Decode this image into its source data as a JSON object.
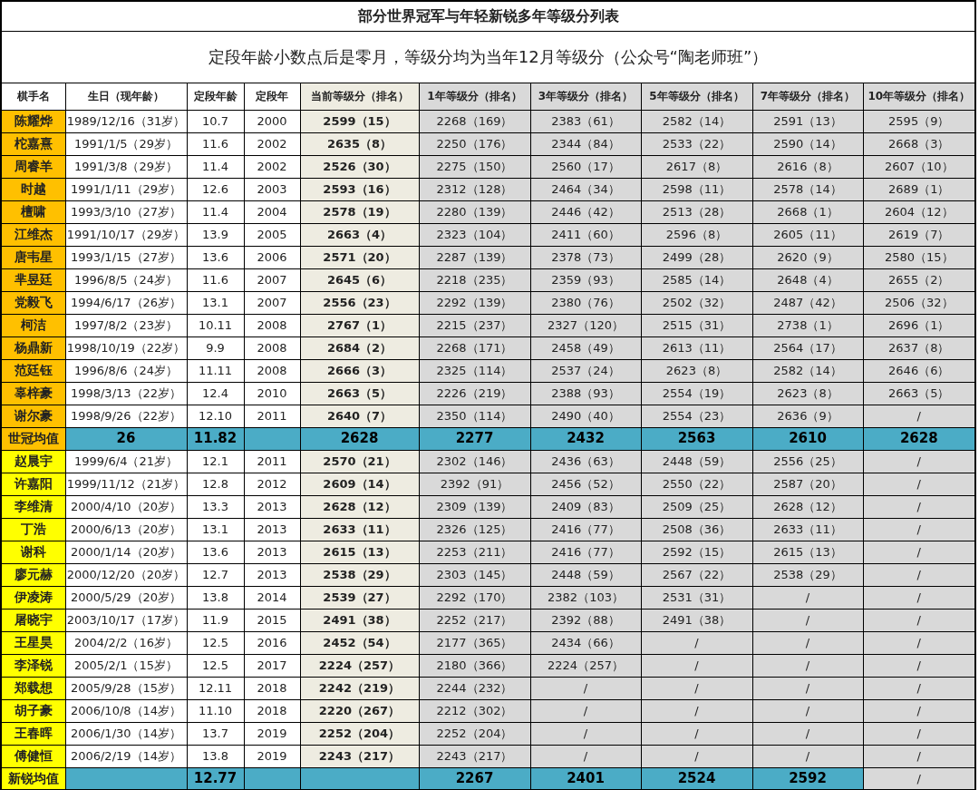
{
  "title": "部分世界冠军与年轻新锐多年等级分列表",
  "subtitle": "定段年龄小数点后是零月，等级分均为当年12月等级分（公众号“陶老师班”）",
  "columns": [
    "棋手名",
    "生日（现年龄）",
    "定段年龄",
    "定段年",
    "当前等级分（排名）",
    "1年等级分（排名）",
    "3年等级分（排名）",
    "5年等级分（排名）",
    "7年等级分（排名）",
    "10年等级分（排名）"
  ],
  "sections": [
    {
      "kind": "champion",
      "players": [
        [
          "陈耀烨",
          "1989/12/16（31岁）",
          "10.7",
          "2000",
          "2599（15）",
          "2268（169）",
          "2383（61）",
          "2582（14）",
          "2591（13）",
          "2595（9）"
        ],
        [
          "柁嘉熹",
          "1991/1/5（29岁）",
          "11.6",
          "2002",
          "2635（8）",
          "2250（176）",
          "2344（84）",
          "2533（22）",
          "2590（14）",
          "2668（3）"
        ],
        [
          "周睿羊",
          "1991/3/8（29岁）",
          "11.4",
          "2002",
          "2526（30）",
          "2275（150）",
          "2560（17）",
          "2617（8）",
          "2616（8）",
          "2607（10）"
        ],
        [
          "时越",
          "1991/1/11（29岁）",
          "12.6",
          "2003",
          "2593（16）",
          "2312（128）",
          "2464（34）",
          "2598（11）",
          "2578（14）",
          "2689（1）"
        ],
        [
          "檀啸",
          "1993/3/10（27岁）",
          "11.4",
          "2004",
          "2578（19）",
          "2280（139）",
          "2446（42）",
          "2513（28）",
          "2668（1）",
          "2604（12）"
        ],
        [
          "江维杰",
          "1991/10/17（29岁）",
          "13.9",
          "2005",
          "2663（4）",
          "2323（104）",
          "2411（60）",
          "2596（8）",
          "2605（11）",
          "2619（7）"
        ],
        [
          "唐韦星",
          "1993/1/15（27岁）",
          "13.6",
          "2006",
          "2571（20）",
          "2287（139）",
          "2378（73）",
          "2499（28）",
          "2620（9）",
          "2580（15）"
        ],
        [
          "芈昱廷",
          "1996/8/5（24岁）",
          "11.6",
          "2007",
          "2645（6）",
          "2218（235）",
          "2359（93）",
          "2585（14）",
          "2648（4）",
          "2655（2）"
        ],
        [
          "党毅飞",
          "1994/6/17（26岁）",
          "13.1",
          "2007",
          "2556（23）",
          "2292（139）",
          "2380（76）",
          "2502（32）",
          "2487（42）",
          "2506（32）"
        ],
        [
          "柯洁",
          "1997/8/2（23岁）",
          "10.11",
          "2008",
          "2767（1）",
          "2215（237）",
          "2327（120）",
          "2515（31）",
          "2738（1）",
          "2696（1）"
        ],
        [
          "杨鼎新",
          "1998/10/19（22岁）",
          "9.9",
          "2008",
          "2684（2）",
          "2268（171）",
          "2458（49）",
          "2613（11）",
          "2564（17）",
          "2637（8）"
        ],
        [
          "范廷钰",
          "1996/8/6（24岁）",
          "11.11",
          "2008",
          "2666（3）",
          "2325（114）",
          "2537（24）",
          "2623（8）",
          "2582（14）",
          "2646（6）"
        ],
        [
          "辜梓豪",
          "1998/3/13（22岁）",
          "12.4",
          "2010",
          "2663（5）",
          "2226（219）",
          "2388（93）",
          "2554（19）",
          "2623（8）",
          "2663（5）"
        ],
        [
          "谢尔豪",
          "1998/9/26（22岁）",
          "12.10",
          "2011",
          "2640（7）",
          "2350（114）",
          "2490（40）",
          "2554（23）",
          "2636（9）",
          "/"
        ]
      ],
      "average": {
        "label": "世冠均值",
        "cells": [
          {
            "text": "26",
            "highlighted": true
          },
          {
            "text": "11.82",
            "highlighted": true
          },
          null,
          {
            "text": "2628",
            "highlighted": true
          },
          {
            "text": "2277",
            "highlighted": true
          },
          {
            "text": "2432",
            "highlighted": true
          },
          {
            "text": "2563",
            "highlighted": true
          },
          {
            "text": "2610",
            "highlighted": true
          },
          {
            "text": "2628",
            "highlighted": true
          }
        ]
      }
    },
    {
      "kind": "rising",
      "players": [
        [
          "赵晨宇",
          "1999/6/4（21岁）",
          "12.1",
          "2011",
          "2570（21）",
          "2302（146）",
          "2436（63）",
          "2448（59）",
          "2556（25）",
          "/"
        ],
        [
          "许嘉阳",
          "1999/11/12（21岁）",
          "12.8",
          "2012",
          "2609（14）",
          "2392（91）",
          "2456（52）",
          "2550（22）",
          "2587（20）",
          "/"
        ],
        [
          "李维清",
          "2000/4/10（20岁）",
          "13.3",
          "2013",
          "2628（12）",
          "2309（139）",
          "2409（83）",
          "2509（25）",
          "2628（12）",
          "/"
        ],
        [
          "丁浩",
          "2000/6/13（20岁）",
          "13.1",
          "2013",
          "2633（11）",
          "2326（125）",
          "2416（77）",
          "2508（36）",
          "2633（11）",
          "/"
        ],
        [
          "谢科",
          "2000/1/14（20岁）",
          "13.6",
          "2013",
          "2615（13）",
          "2253（211）",
          "2416（77）",
          "2592（15）",
          "2615（13）",
          "/"
        ],
        [
          "廖元赫",
          "2000/12/20（20岁）",
          "12.7",
          "2013",
          "2538（29）",
          "2303（145）",
          "2448（59）",
          "2567（22）",
          "2538（29）",
          "/"
        ],
        [
          "伊凌涛",
          "2000/5/29（20岁）",
          "13.8",
          "2014",
          "2539（27）",
          "2292（170）",
          "2382（103）",
          "2531（31）",
          "/",
          "/"
        ],
        [
          "屠晓宇",
          "2003/10/17（17岁）",
          "11.9",
          "2015",
          "2491（38）",
          "2252（217）",
          "2392（88）",
          "2491（38）",
          "/",
          "/"
        ],
        [
          "王星昊",
          "2004/2/2（16岁）",
          "12.5",
          "2016",
          "2452（54）",
          "2177（365）",
          "2434（66）",
          "/",
          "/",
          "/"
        ],
        [
          "李泽锐",
          "2005/2/1（15岁）",
          "12.5",
          "2017",
          "2224（257）",
          "2180（366）",
          "2224（257）",
          "/",
          "/",
          "/"
        ],
        [
          "郑载想",
          "2005/9/28（15岁）",
          "12.11",
          "2018",
          "2242（219）",
          "2244（232）",
          "/",
          "/",
          "/",
          "/"
        ],
        [
          "胡子豪",
          "2006/10/8（14岁）",
          "11.10",
          "2018",
          "2220（267）",
          "2212（302）",
          "/",
          "/",
          "/",
          "/"
        ],
        [
          "王春晖",
          "2006/1/30（14岁）",
          "13.7",
          "2019",
          "2252（204）",
          "2252（204）",
          "/",
          "/",
          "/",
          "/"
        ],
        [
          "傅健恒",
          "2006/2/19（14岁）",
          "13.8",
          "2019",
          "2243（217）",
          "2243（217）",
          "/",
          "/",
          "/",
          "/"
        ]
      ],
      "average": {
        "label": "新锐均值",
        "cells": [
          null,
          {
            "text": "12.77",
            "highlighted": true
          },
          null,
          null,
          {
            "text": "2267",
            "highlighted": true
          },
          {
            "text": "2401",
            "highlighted": true
          },
          {
            "text": "2524",
            "highlighted": true
          },
          {
            "text": "2592",
            "highlighted": true
          },
          {
            "text": "/",
            "highlighted": false
          }
        ]
      }
    }
  ]
}
